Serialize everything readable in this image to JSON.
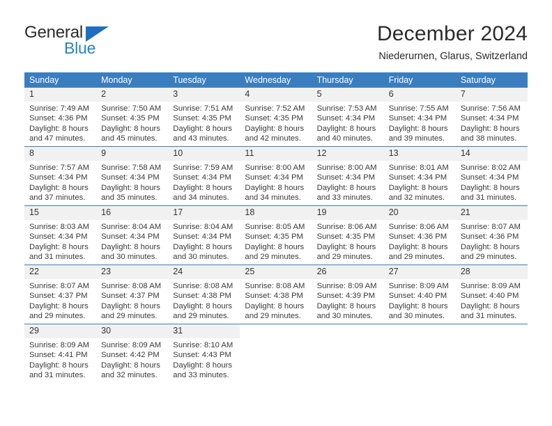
{
  "brand": {
    "name_part1": "General",
    "name_part2": "Blue",
    "triangle_color": "#1f6fc0",
    "blue_text_color": "#2484c6"
  },
  "header": {
    "title": "December 2024",
    "subtitle": "Niederurnen, Glarus, Switzerland"
  },
  "theme": {
    "header_bg": "#3a7ec0",
    "daynum_bg": "#f1f1f1",
    "text_color": "#3a3a3a"
  },
  "calendar": {
    "weekday_headers": [
      "Sunday",
      "Monday",
      "Tuesday",
      "Wednesday",
      "Thursday",
      "Friday",
      "Saturday"
    ],
    "weeks": [
      [
        {
          "day": "1",
          "sunrise": "Sunrise: 7:49 AM",
          "sunset": "Sunset: 4:36 PM",
          "daylight1": "Daylight: 8 hours",
          "daylight2": "and 47 minutes."
        },
        {
          "day": "2",
          "sunrise": "Sunrise: 7:50 AM",
          "sunset": "Sunset: 4:35 PM",
          "daylight1": "Daylight: 8 hours",
          "daylight2": "and 45 minutes."
        },
        {
          "day": "3",
          "sunrise": "Sunrise: 7:51 AM",
          "sunset": "Sunset: 4:35 PM",
          "daylight1": "Daylight: 8 hours",
          "daylight2": "and 43 minutes."
        },
        {
          "day": "4",
          "sunrise": "Sunrise: 7:52 AM",
          "sunset": "Sunset: 4:35 PM",
          "daylight1": "Daylight: 8 hours",
          "daylight2": "and 42 minutes."
        },
        {
          "day": "5",
          "sunrise": "Sunrise: 7:53 AM",
          "sunset": "Sunset: 4:34 PM",
          "daylight1": "Daylight: 8 hours",
          "daylight2": "and 40 minutes."
        },
        {
          "day": "6",
          "sunrise": "Sunrise: 7:55 AM",
          "sunset": "Sunset: 4:34 PM",
          "daylight1": "Daylight: 8 hours",
          "daylight2": "and 39 minutes."
        },
        {
          "day": "7",
          "sunrise": "Sunrise: 7:56 AM",
          "sunset": "Sunset: 4:34 PM",
          "daylight1": "Daylight: 8 hours",
          "daylight2": "and 38 minutes."
        }
      ],
      [
        {
          "day": "8",
          "sunrise": "Sunrise: 7:57 AM",
          "sunset": "Sunset: 4:34 PM",
          "daylight1": "Daylight: 8 hours",
          "daylight2": "and 37 minutes."
        },
        {
          "day": "9",
          "sunrise": "Sunrise: 7:58 AM",
          "sunset": "Sunset: 4:34 PM",
          "daylight1": "Daylight: 8 hours",
          "daylight2": "and 35 minutes."
        },
        {
          "day": "10",
          "sunrise": "Sunrise: 7:59 AM",
          "sunset": "Sunset: 4:34 PM",
          "daylight1": "Daylight: 8 hours",
          "daylight2": "and 34 minutes."
        },
        {
          "day": "11",
          "sunrise": "Sunrise: 8:00 AM",
          "sunset": "Sunset: 4:34 PM",
          "daylight1": "Daylight: 8 hours",
          "daylight2": "and 34 minutes."
        },
        {
          "day": "12",
          "sunrise": "Sunrise: 8:00 AM",
          "sunset": "Sunset: 4:34 PM",
          "daylight1": "Daylight: 8 hours",
          "daylight2": "and 33 minutes."
        },
        {
          "day": "13",
          "sunrise": "Sunrise: 8:01 AM",
          "sunset": "Sunset: 4:34 PM",
          "daylight1": "Daylight: 8 hours",
          "daylight2": "and 32 minutes."
        },
        {
          "day": "14",
          "sunrise": "Sunrise: 8:02 AM",
          "sunset": "Sunset: 4:34 PM",
          "daylight1": "Daylight: 8 hours",
          "daylight2": "and 31 minutes."
        }
      ],
      [
        {
          "day": "15",
          "sunrise": "Sunrise: 8:03 AM",
          "sunset": "Sunset: 4:34 PM",
          "daylight1": "Daylight: 8 hours",
          "daylight2": "and 31 minutes."
        },
        {
          "day": "16",
          "sunrise": "Sunrise: 8:04 AM",
          "sunset": "Sunset: 4:34 PM",
          "daylight1": "Daylight: 8 hours",
          "daylight2": "and 30 minutes."
        },
        {
          "day": "17",
          "sunrise": "Sunrise: 8:04 AM",
          "sunset": "Sunset: 4:34 PM",
          "daylight1": "Daylight: 8 hours",
          "daylight2": "and 30 minutes."
        },
        {
          "day": "18",
          "sunrise": "Sunrise: 8:05 AM",
          "sunset": "Sunset: 4:35 PM",
          "daylight1": "Daylight: 8 hours",
          "daylight2": "and 29 minutes."
        },
        {
          "day": "19",
          "sunrise": "Sunrise: 8:06 AM",
          "sunset": "Sunset: 4:35 PM",
          "daylight1": "Daylight: 8 hours",
          "daylight2": "and 29 minutes."
        },
        {
          "day": "20",
          "sunrise": "Sunrise: 8:06 AM",
          "sunset": "Sunset: 4:36 PM",
          "daylight1": "Daylight: 8 hours",
          "daylight2": "and 29 minutes."
        },
        {
          "day": "21",
          "sunrise": "Sunrise: 8:07 AM",
          "sunset": "Sunset: 4:36 PM",
          "daylight1": "Daylight: 8 hours",
          "daylight2": "and 29 minutes."
        }
      ],
      [
        {
          "day": "22",
          "sunrise": "Sunrise: 8:07 AM",
          "sunset": "Sunset: 4:37 PM",
          "daylight1": "Daylight: 8 hours",
          "daylight2": "and 29 minutes."
        },
        {
          "day": "23",
          "sunrise": "Sunrise: 8:08 AM",
          "sunset": "Sunset: 4:37 PM",
          "daylight1": "Daylight: 8 hours",
          "daylight2": "and 29 minutes."
        },
        {
          "day": "24",
          "sunrise": "Sunrise: 8:08 AM",
          "sunset": "Sunset: 4:38 PM",
          "daylight1": "Daylight: 8 hours",
          "daylight2": "and 29 minutes."
        },
        {
          "day": "25",
          "sunrise": "Sunrise: 8:08 AM",
          "sunset": "Sunset: 4:38 PM",
          "daylight1": "Daylight: 8 hours",
          "daylight2": "and 29 minutes."
        },
        {
          "day": "26",
          "sunrise": "Sunrise: 8:09 AM",
          "sunset": "Sunset: 4:39 PM",
          "daylight1": "Daylight: 8 hours",
          "daylight2": "and 30 minutes."
        },
        {
          "day": "27",
          "sunrise": "Sunrise: 8:09 AM",
          "sunset": "Sunset: 4:40 PM",
          "daylight1": "Daylight: 8 hours",
          "daylight2": "and 30 minutes."
        },
        {
          "day": "28",
          "sunrise": "Sunrise: 8:09 AM",
          "sunset": "Sunset: 4:40 PM",
          "daylight1": "Daylight: 8 hours",
          "daylight2": "and 31 minutes."
        }
      ],
      [
        {
          "day": "29",
          "sunrise": "Sunrise: 8:09 AM",
          "sunset": "Sunset: 4:41 PM",
          "daylight1": "Daylight: 8 hours",
          "daylight2": "and 31 minutes."
        },
        {
          "day": "30",
          "sunrise": "Sunrise: 8:09 AM",
          "sunset": "Sunset: 4:42 PM",
          "daylight1": "Daylight: 8 hours",
          "daylight2": "and 32 minutes."
        },
        {
          "day": "31",
          "sunrise": "Sunrise: 8:10 AM",
          "sunset": "Sunset: 4:43 PM",
          "daylight1": "Daylight: 8 hours",
          "daylight2": "and 33 minutes."
        },
        {
          "day": "",
          "sunrise": "",
          "sunset": "",
          "daylight1": "",
          "daylight2": ""
        },
        {
          "day": "",
          "sunrise": "",
          "sunset": "",
          "daylight1": "",
          "daylight2": ""
        },
        {
          "day": "",
          "sunrise": "",
          "sunset": "",
          "daylight1": "",
          "daylight2": ""
        },
        {
          "day": "",
          "sunrise": "",
          "sunset": "",
          "daylight1": "",
          "daylight2": ""
        }
      ]
    ]
  }
}
